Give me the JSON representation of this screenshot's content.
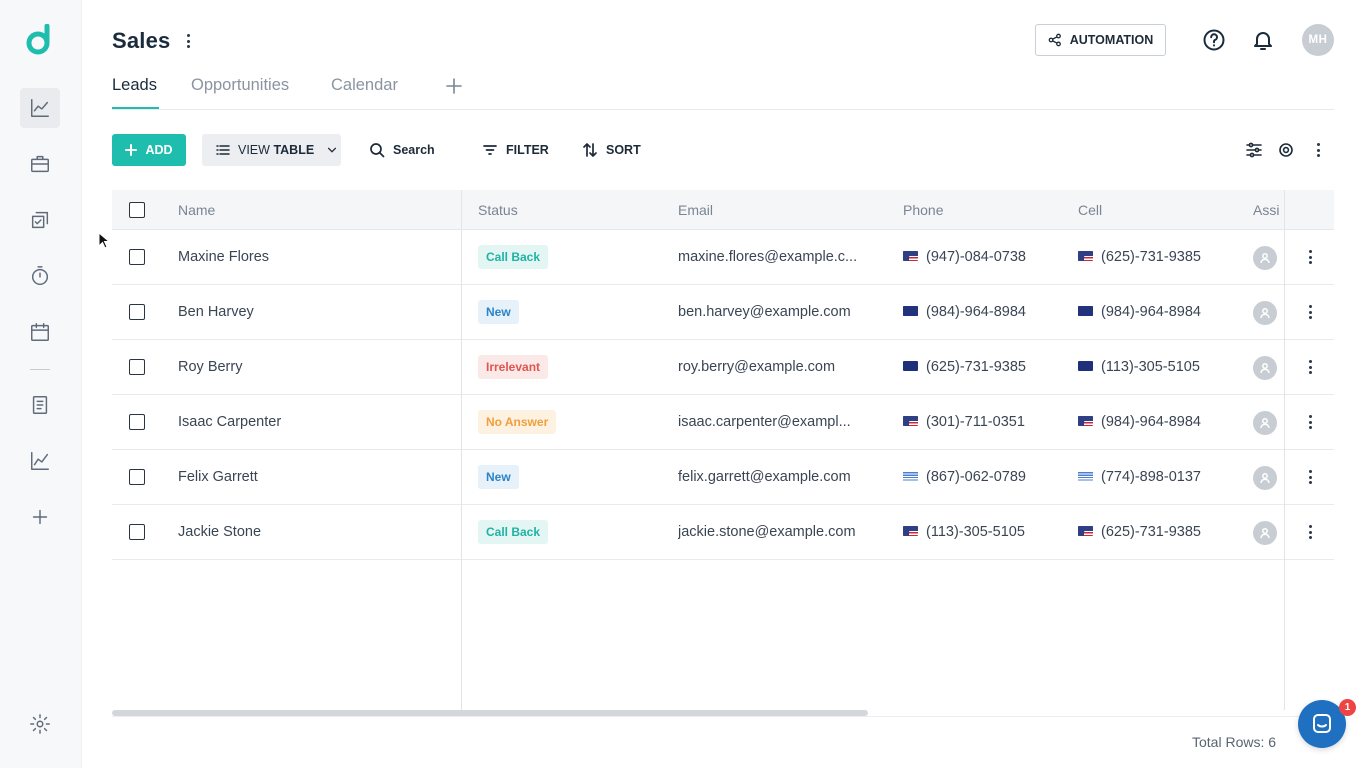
{
  "app": {
    "title": "Sales",
    "brand_color": "#1fbdad",
    "logo": "d"
  },
  "sidebar": {
    "items": [
      {
        "name": "analytics",
        "icon": "line-chart-icon",
        "active": true
      },
      {
        "name": "briefcase",
        "icon": "briefcase-icon",
        "active": false
      },
      {
        "name": "tasks",
        "icon": "checklist-icon",
        "active": false
      },
      {
        "name": "timer",
        "icon": "stopwatch-icon",
        "active": false
      },
      {
        "name": "calendar",
        "icon": "calendar-icon",
        "active": false
      },
      {
        "name": "notes",
        "icon": "document-icon",
        "active": false
      },
      {
        "name": "reports",
        "icon": "trend-chart-icon",
        "active": false
      },
      {
        "name": "add",
        "icon": "plus-icon",
        "active": false
      },
      {
        "name": "settings",
        "icon": "gear-icon",
        "active": false
      }
    ]
  },
  "header": {
    "automation_label": "AUTOMATION",
    "avatar_initials": "MH"
  },
  "tabs": [
    {
      "label": "Leads",
      "active": true
    },
    {
      "label": "Opportunities",
      "active": false
    },
    {
      "label": "Calendar",
      "active": false
    }
  ],
  "toolbar": {
    "add_label": "ADD",
    "view_prefix": "VIEW",
    "view_value": "TABLE",
    "search_label": "Search",
    "filter_label": "FILTER",
    "sort_label": "SORT"
  },
  "table": {
    "columns": [
      "Name",
      "Status",
      "Email",
      "Phone",
      "Cell",
      "Assi"
    ],
    "rows": [
      {
        "name": "Maxine Flores",
        "status": "Call Back",
        "email": "maxine.flores@example.c...",
        "phone_flag": "us",
        "phone": "(947)-084-0738",
        "cell_flag": "us",
        "cell": "(625)-731-9385"
      },
      {
        "name": "Ben Harvey",
        "status": "New",
        "email": "ben.harvey@example.com",
        "phone_flag": "gb",
        "phone": "(984)-964-8984",
        "cell_flag": "gb",
        "cell": "(984)-964-8984"
      },
      {
        "name": "Roy Berry",
        "status": "Irrelevant",
        "email": "roy.berry@example.com",
        "phone_flag": "au",
        "phone": "(625)-731-9385",
        "cell_flag": "au",
        "cell": "(113)-305-5105"
      },
      {
        "name": "Isaac Carpenter",
        "status": "No Answer",
        "email": "isaac.carpenter@exampl...",
        "phone_flag": "us",
        "phone": "(301)-711-0351",
        "cell_flag": "us",
        "cell": "(984)-964-8984"
      },
      {
        "name": "Felix Garrett",
        "status": "New",
        "email": "felix.garrett@example.com",
        "phone_flag": "uy",
        "phone": "(867)-062-0789",
        "cell_flag": "uy",
        "cell": "(774)-898-0137"
      },
      {
        "name": "Jackie Stone",
        "status": "Call Back",
        "email": "jackie.stone@example.com",
        "phone_flag": "us",
        "phone": "(113)-305-5105",
        "cell_flag": "us",
        "cell": "(625)-731-9385"
      }
    ],
    "status_colors": {
      "Call Back": {
        "fg": "#1fb3a3",
        "bg": "#e4f6f4"
      },
      "New": {
        "fg": "#2a84c7",
        "bg": "#e6f1fa"
      },
      "Irrelevant": {
        "fg": "#e0554f",
        "bg": "#fbe9e8"
      },
      "No Answer": {
        "fg": "#f0a03a",
        "bg": "#fdf1e1"
      }
    }
  },
  "footer": {
    "total_rows_label": "Total Rows: 6"
  },
  "chat": {
    "badge_count": "1"
  }
}
